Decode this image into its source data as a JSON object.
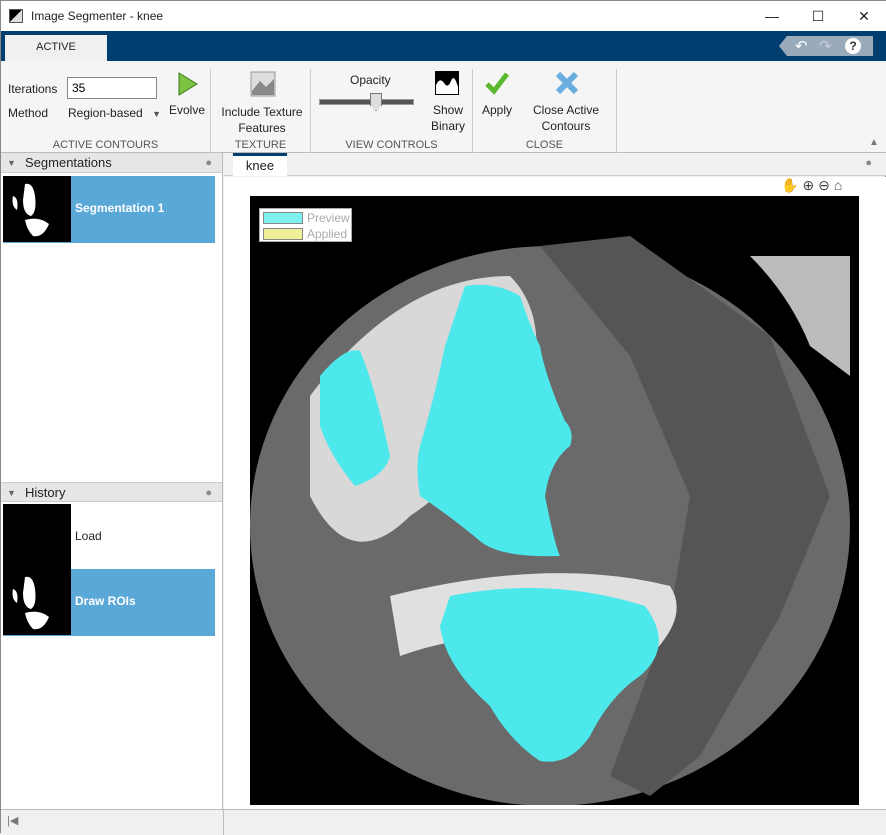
{
  "window": {
    "title": "Image Segmenter - knee",
    "minimize": "—",
    "maximize": "☐",
    "close": "✕"
  },
  "tab": "ACTIVE CONTOURS",
  "quick_access": {
    "undo": "↶",
    "redo": "↷",
    "help": "?"
  },
  "toolstrip": {
    "active_contours": {
      "iterations_label": "Iterations",
      "iterations_value": "35",
      "method_label": "Method",
      "method_value": "Region-based",
      "evolve": "Evolve",
      "section": "ACTIVE CONTOURS"
    },
    "texture": {
      "button": "Include Texture Features",
      "section": "TEXTURE"
    },
    "view_controls": {
      "opacity_label": "Opacity",
      "opacity_value_percent": 60,
      "show_binary": "Show Binary",
      "section": "VIEW CONTROLS"
    },
    "close": {
      "apply": "Apply",
      "close": "Close Active Contours",
      "section": "CLOSE"
    }
  },
  "segmentations": {
    "title": "Segmentations",
    "items": [
      {
        "label": "Segmentation 1",
        "selected": true
      }
    ]
  },
  "history": {
    "title": "History",
    "items": [
      {
        "label": "Load"
      },
      {
        "label": "Draw ROIs",
        "selected": true
      }
    ]
  },
  "document_tab": "knee",
  "legend": {
    "preview": "Preview",
    "applied": "Applied",
    "preview_color": "#7ff0f0",
    "applied_color": "#f0f09a"
  },
  "colors": {
    "accent": "#003e70",
    "selected": "#5aa8d8",
    "overlay": "#4de8ec"
  }
}
